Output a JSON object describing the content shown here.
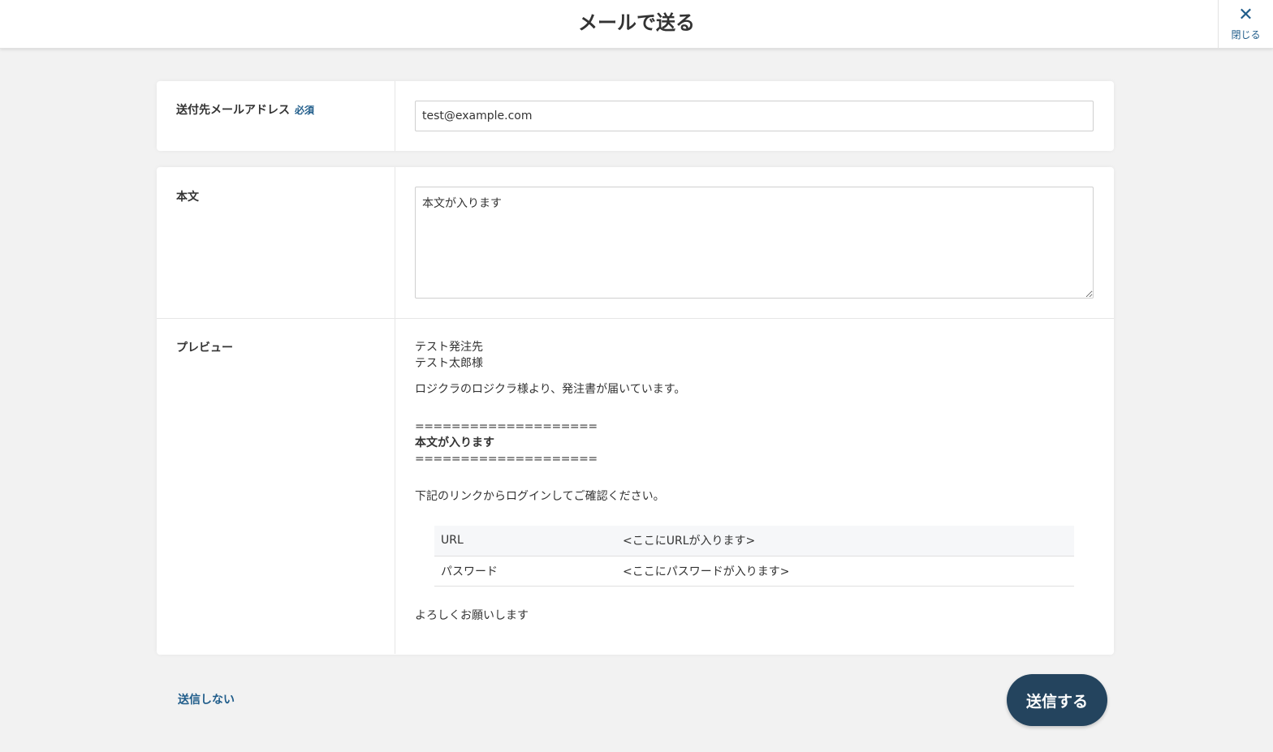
{
  "header": {
    "title": "メールで送る",
    "close_label": "閉じる",
    "close_icon": "close-icon"
  },
  "recipient": {
    "label": "送付先メールアドレス",
    "required_label": "必須",
    "value": "test@example.com"
  },
  "body": {
    "label": "本文",
    "value": "本文が入ります"
  },
  "preview": {
    "label": "プレビュー",
    "line1": "テスト発注先",
    "line2": "テスト太郎様",
    "line3": "ロジクラのロジクラ様より、発注書が届いています。",
    "separator": "====================",
    "body_text": "本文が入ります",
    "line4": "下記のリンクからログインしてご確認ください。",
    "table": [
      {
        "key": "URL",
        "value": "<ここにURLが入ります>"
      },
      {
        "key": "パスワード",
        "value": "<ここにパスワードが入ります>"
      }
    ],
    "closing": "よろしくお願いします"
  },
  "footer": {
    "cancel_label": "送信しない",
    "send_label": "送信する"
  },
  "colors": {
    "accent": "#1f5c8a",
    "send_button": "#24445e",
    "background": "#f2f2f2"
  }
}
